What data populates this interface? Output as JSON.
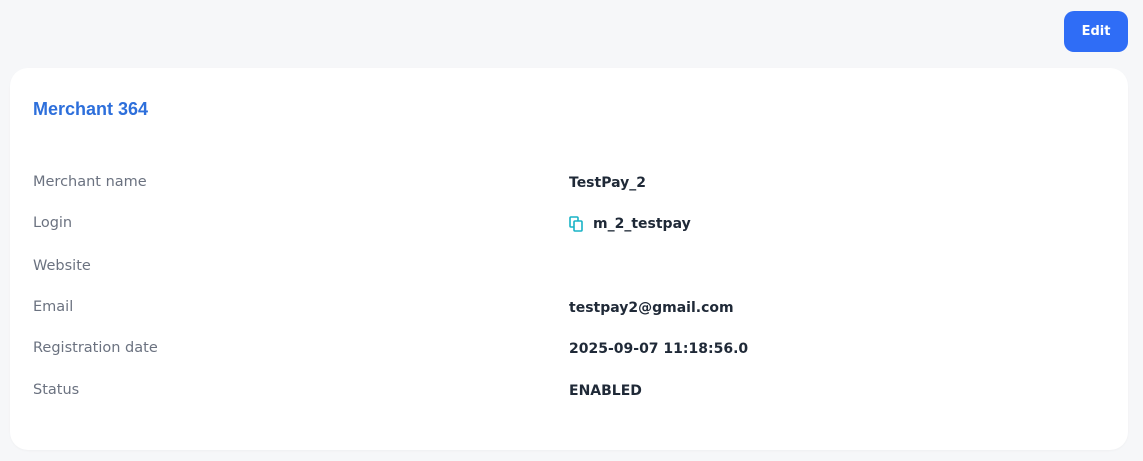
{
  "toolbar": {
    "edit_label": "Edit"
  },
  "card": {
    "title": "Merchant 364",
    "fields": [
      {
        "label": "Merchant name",
        "value": "TestPay_2"
      },
      {
        "label": "Login",
        "value": "m_2_testpay",
        "icon": "copy-icon"
      },
      {
        "label": "Website",
        "value": ""
      },
      {
        "label": "Email",
        "value": "testpay2@gmail.com"
      },
      {
        "label": "Registration date",
        "value": "2025-09-07 11:18:56.0"
      },
      {
        "label": "Status",
        "value": "ENABLED"
      }
    ]
  },
  "colors": {
    "accent": "#2f6df6",
    "title": "#2d6fdb",
    "copy_icon": "#19b3c6",
    "background": "#f6f7f9"
  }
}
